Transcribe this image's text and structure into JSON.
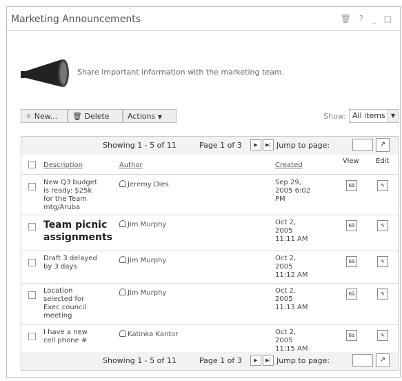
{
  "portlet": {
    "title": "Marketing Announcements",
    "title_icons": [
      "trash-icon",
      "help-icon",
      "minimize-icon",
      "maximize-icon"
    ]
  },
  "intro": {
    "text": "Share important information with the marketing team."
  },
  "toolbar": {
    "new_label": "New...",
    "delete_label": "Delete",
    "actions_label": "Actions",
    "show_label": "Show:",
    "show_value": "All items"
  },
  "pager": {
    "showing": "Showing 1 - 5 of 11",
    "page": "Page 1 of 3",
    "jump": "Jump to page:"
  },
  "columns": {
    "description": "Description",
    "author": "Author",
    "created": "Created",
    "view": "View",
    "edit": "Edit"
  },
  "rows": [
    {
      "description": "New Q3 budget\nis ready: $25k\nfor the Team\nmtg/Aruba",
      "author": "Jeremy Dies",
      "created": "Sep 29,\n2005 6:02\nPM"
    },
    {
      "description": "Team picnic\nassignments",
      "author": "Jim Murphy",
      "created": "Oct 2,\n2005\n11:11 AM"
    },
    {
      "description": "Draft 3 delayed\nby 3 days",
      "author": "Jim Murphy",
      "created": "Oct 2,\n2005\n11:12 AM"
    },
    {
      "description": "Location\nselected for\nExec council\nmeeting",
      "author": "Jim Murphy",
      "created": "Oct 2,\n2005\n11:13 AM"
    },
    {
      "description": "I have a new\ncell phone #",
      "author": "Katinka Kantor",
      "created": "Oct 2,\n2005\n11:15 AM"
    }
  ]
}
